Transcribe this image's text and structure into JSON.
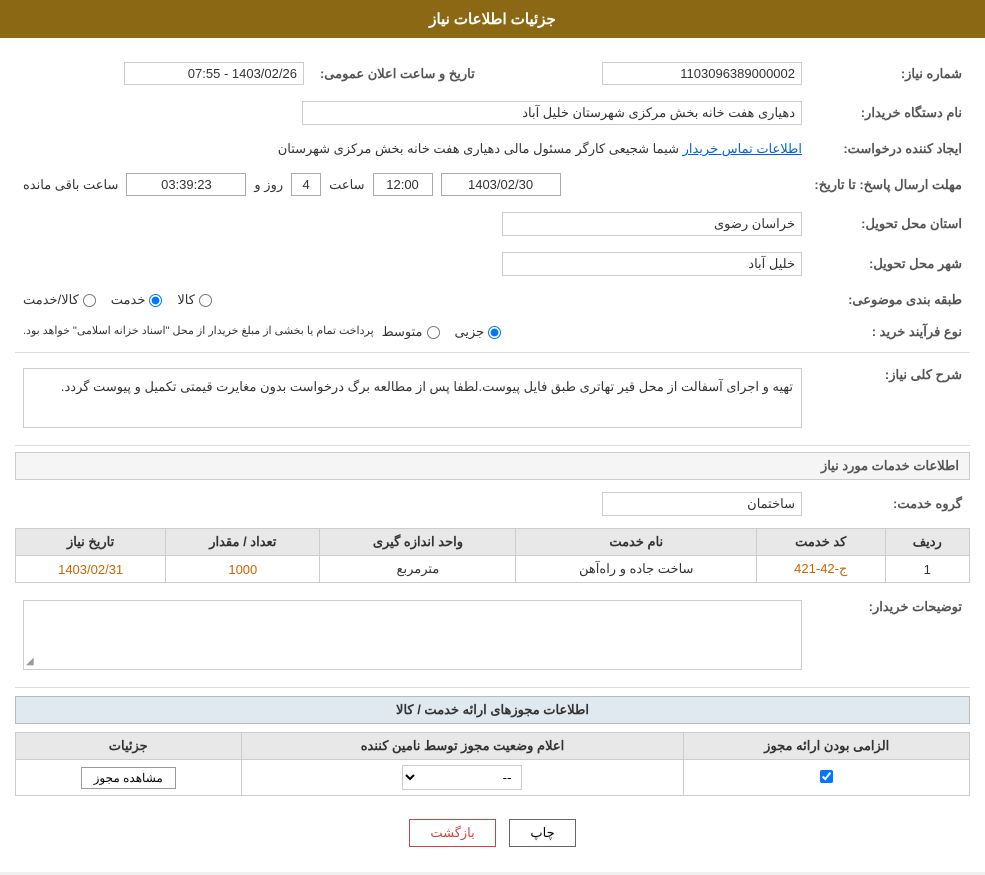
{
  "header": {
    "title": "جزئیات اطلاعات نیاز"
  },
  "info": {
    "need_number_label": "شماره نیاز:",
    "need_number_value": "1103096389000002",
    "announce_datetime_label": "تاریخ و ساعت اعلان عمومی:",
    "announce_datetime_value": "1403/02/26 - 07:55",
    "buyer_org_label": "نام دستگاه خریدار:",
    "buyer_org_value": "دهیاری هفت خانه بخش مرکزی شهرستان خلیل آباد",
    "creator_label": "ایجاد کننده درخواست:",
    "creator_name": "شیما شجیعی کارگر مسئول مالی دهیاری هفت خانه بخش مرکزی شهرستان",
    "creator_link": "اطلاعات تماس خریدار",
    "creator_suffix": ">",
    "deadline_label": "مهلت ارسال پاسخ: تا تاریخ:",
    "deadline_date": "1403/02/30",
    "deadline_time_label": "ساعت",
    "deadline_time": "12:00",
    "deadline_days_label": "روز و",
    "deadline_days": "4",
    "deadline_remaining_label": "ساعت باقی مانده",
    "deadline_remaining": "03:39:23",
    "province_label": "استان محل تحویل:",
    "province_value": "خراسان رضوی",
    "city_label": "شهر محل تحویل:",
    "city_value": "خلیل آباد",
    "category_label": "طبقه بندی موضوعی:",
    "category_options": [
      "کالا",
      "خدمت",
      "کالا/خدمت"
    ],
    "category_selected": "خدمت",
    "process_label": "نوع فرآیند خرید :",
    "process_options": [
      "جزیی",
      "متوسط"
    ],
    "process_selected": "جزیی",
    "process_note": "پرداخت تمام یا بخشی از مبلغ خریدار از محل \"اسناد خزانه اسلامی\" خواهد بود."
  },
  "description": {
    "title": "شرح کلی نیاز:",
    "text": "تهیه و اجرای آسفالت از محل قیر تهاتری طبق فایل پیوست.لطفا پس از مطالعه برگ درخواست بدون مغایرت قیمتی تکمیل و پیوست گردد."
  },
  "services_section": {
    "title": "اطلاعات خدمات مورد نیاز",
    "group_label": "گروه خدمت:",
    "group_value": "ساختمان",
    "table": {
      "headers": [
        "ردیف",
        "کد خدمت",
        "نام خدمت",
        "واحد اندازه گیری",
        "تعداد / مقدار",
        "تاریخ نیاز"
      ],
      "rows": [
        {
          "row": "1",
          "code": "ج-42-421",
          "name": "ساخت جاده و راه‌آهن",
          "unit": "مترمربع",
          "quantity": "1000",
          "date": "1403/02/31"
        }
      ]
    }
  },
  "buyer_notes": {
    "title": "توضیحات خریدار:"
  },
  "licenses_section": {
    "title": "اطلاعات مجوزهای ارائه خدمت / کالا",
    "table": {
      "headers": [
        "الزامی بودن ارائه مجوز",
        "اعلام وضعیت مجوز توسط نامین کننده",
        "جزئیات"
      ],
      "rows": [
        {
          "required": true,
          "status": "--",
          "details_btn": "مشاهده مجوز"
        }
      ]
    }
  },
  "footer": {
    "print_btn": "چاپ",
    "back_btn": "بازگشت"
  }
}
